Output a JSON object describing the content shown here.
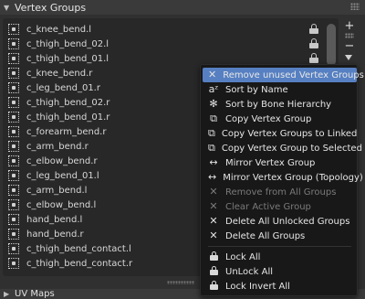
{
  "panel": {
    "title": "Vertex Groups",
    "collapse_icon": "triangle-down"
  },
  "vertex_groups": [
    {
      "name": "c_knee_bend.l"
    },
    {
      "name": "c_thigh_bend_02.l"
    },
    {
      "name": "c_thigh_bend_01.l"
    },
    {
      "name": "c_knee_bend.r"
    },
    {
      "name": "c_leg_bend_01.r"
    },
    {
      "name": "c_thigh_bend_02.r"
    },
    {
      "name": "c_thigh_bend_01.r"
    },
    {
      "name": "c_forearm_bend.r"
    },
    {
      "name": "c_arm_bend.r"
    },
    {
      "name": "c_elbow_bend.r"
    },
    {
      "name": "c_leg_bend_01.l"
    },
    {
      "name": "c_arm_bend.l"
    },
    {
      "name": "c_elbow_bend.l"
    },
    {
      "name": "hand_bend.l"
    },
    {
      "name": "hand_bend.r"
    },
    {
      "name": "c_thigh_bend_contact.l"
    },
    {
      "name": "c_thigh_bend_contact.r"
    }
  ],
  "side_buttons": {
    "add": "+",
    "remove": "−"
  },
  "context_menu": {
    "items": [
      {
        "label": "Remove unused Vertex Groups",
        "icon": "✕",
        "state": "active"
      },
      {
        "label": "Sort by Name",
        "icon": "aᶻ",
        "state": "normal"
      },
      {
        "label": "Sort by Bone Hierarchy",
        "icon": "✻",
        "state": "normal"
      },
      {
        "label": "Copy Vertex Group",
        "icon": "⧉",
        "state": "normal"
      },
      {
        "label": "Copy Vertex Groups to Linked",
        "icon": "⧉",
        "state": "normal"
      },
      {
        "label": "Copy Vertex Group to Selected",
        "icon": "⧉",
        "state": "normal"
      },
      {
        "label": "Mirror Vertex Group",
        "icon": "↔",
        "state": "normal"
      },
      {
        "label": "Mirror Vertex Group (Topology)",
        "icon": "↔",
        "state": "normal"
      },
      {
        "label": "Remove from All Groups",
        "icon": "✕",
        "state": "disabled"
      },
      {
        "label": "Clear Active Group",
        "icon": "✕",
        "state": "disabled"
      },
      {
        "label": "Delete All Unlocked Groups",
        "icon": "✕",
        "state": "normal"
      },
      {
        "label": "Delete All Groups",
        "icon": "✕",
        "state": "normal"
      },
      {
        "label": "Lock All",
        "icon": "🔒",
        "state": "normal"
      },
      {
        "label": "UnLock All",
        "icon": "🔒",
        "state": "normal"
      },
      {
        "label": "Lock Invert All",
        "icon": "🔒",
        "state": "normal"
      }
    ]
  },
  "uv_panel": {
    "title": "UV Maps"
  },
  "colors": {
    "accent": "#5680c2",
    "background": "#303030",
    "menu_background": "#181818"
  }
}
